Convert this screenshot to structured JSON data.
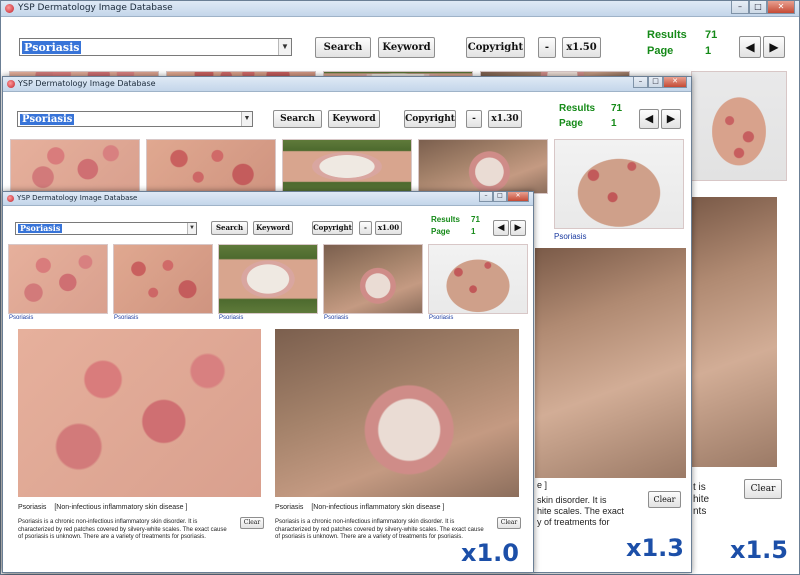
{
  "app": {
    "title": "YSP Dermatology Image Database"
  },
  "toolbar": {
    "search_value": "Psoriasis",
    "search_button": "Search",
    "keyword_button": "Keyword",
    "copyright_button": "Copyright",
    "zoom_out_button": "-",
    "prev_icon": "triangle-left",
    "next_icon": "triangle-right"
  },
  "results": {
    "label": "Results",
    "count": "71",
    "page_label": "Page",
    "page": "1"
  },
  "windows": {
    "x15": {
      "zoom_button": "x1.50",
      "zoom_overlay": "x1.5",
      "clear_button": "Clear",
      "desc_fragment_1": "t is",
      "desc_fragment_2": "hite",
      "desc_fragment_3": "nts"
    },
    "x13": {
      "zoom_button": "x1.30",
      "zoom_overlay": "x1.3",
      "clear_button": "Clear",
      "thumb_caption": "Psoriasis",
      "detail_fragment_1": "e ]",
      "detail_fragment_2": "skin disorder. It is",
      "detail_fragment_3": "hite scales. The exact",
      "detail_fragment_4": "y of treatments for"
    },
    "x10": {
      "zoom_button": "x1.00",
      "zoom_overlay": "x1.0",
      "clear_button": "Clear"
    }
  },
  "thumbnails": [
    {
      "caption": "Psoriasis"
    },
    {
      "caption": "Psoriasis"
    },
    {
      "caption": "Psoriasis"
    },
    {
      "caption": "Psoriasis"
    },
    {
      "caption": "Psoriasis"
    }
  ],
  "details": [
    {
      "name": "Psoriasis",
      "category": "[Non-infectious inflammatory skin disease ]",
      "description": "Psoriasis is a chronic non-infectious inflammatory skin disorder. It is characterized by red patches covered by silvery-white scales. The exact cause of psoriasis is unknown. There are a variety of treatments for psoriasis.",
      "clear": "Clear"
    },
    {
      "name": "Psoriasis",
      "category": "[Non-infectious inflammatory skin disease ]",
      "description": "Psoriasis is a chronic non-infectious inflammatory skin disorder. It is characterized by red patches covered by silvery-white scales. The exact cause of psoriasis is unknown. There are a variety of treatments for psoriasis.",
      "clear": "Clear"
    }
  ],
  "colors": {
    "results_green": "#158a18",
    "selection_blue": "#3874d8",
    "caption_blue": "#1a3aa0",
    "zoom_overlay_blue": "#1c4fa8"
  }
}
